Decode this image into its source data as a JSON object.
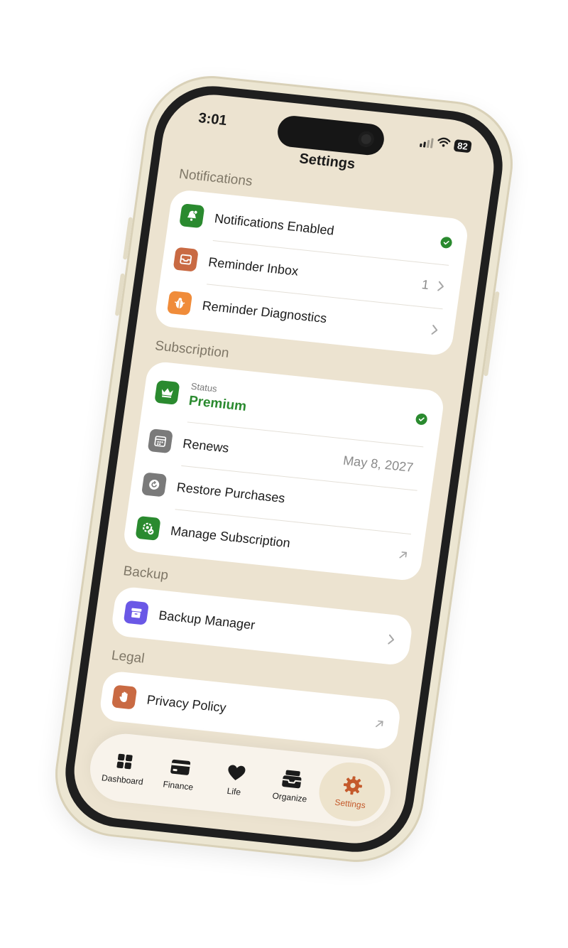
{
  "status_bar": {
    "time": "3:01",
    "battery": "82"
  },
  "nav": {
    "title": "Settings"
  },
  "sections": {
    "notifications": {
      "header": "Notifications",
      "notifications_enabled": {
        "label": "Notifications Enabled",
        "icon": "bell-badge-icon",
        "color": "#2a8a2f"
      },
      "reminder_inbox": {
        "label": "Reminder Inbox",
        "value": "1",
        "icon": "tray-icon",
        "color": "#c96a43"
      },
      "reminder_diagnostics": {
        "label": "Reminder Diagnostics",
        "icon": "ladybug-icon",
        "color": "#f08c3a"
      }
    },
    "subscription": {
      "header": "Subscription",
      "status": {
        "sublabel": "Status",
        "value": "Premium",
        "icon": "crown-icon",
        "color": "#2a8a2f"
      },
      "renews": {
        "label": "Renews",
        "value": "May 8, 2027",
        "icon": "calendar-icon",
        "color": "#7a7a7a"
      },
      "restore": {
        "label": "Restore Purchases",
        "icon": "restore-icon",
        "color": "#7a7a7a"
      },
      "manage": {
        "label": "Manage Subscription",
        "icon": "gear-check-icon",
        "color": "#2a8a2f"
      }
    },
    "backup": {
      "header": "Backup",
      "manager": {
        "label": "Backup Manager",
        "icon": "archivebox-icon",
        "color": "#6a58e6"
      }
    },
    "legal": {
      "header": "Legal",
      "privacy": {
        "label": "Privacy Policy",
        "icon": "hand-raised-icon",
        "color": "#c96a43"
      }
    }
  },
  "tabs": [
    {
      "label": "Dashboard",
      "icon": "grid-icon",
      "active": false
    },
    {
      "label": "Finance",
      "icon": "card-icon",
      "active": false
    },
    {
      "label": "Life",
      "icon": "heart-icon",
      "active": false
    },
    {
      "label": "Organize",
      "icon": "tray-full-icon",
      "active": false
    },
    {
      "label": "Settings",
      "icon": "gear-icon",
      "active": true
    }
  ],
  "colors": {
    "background": "#ece3d0",
    "accent": "#c45a2c",
    "success": "#2a8a2f"
  }
}
